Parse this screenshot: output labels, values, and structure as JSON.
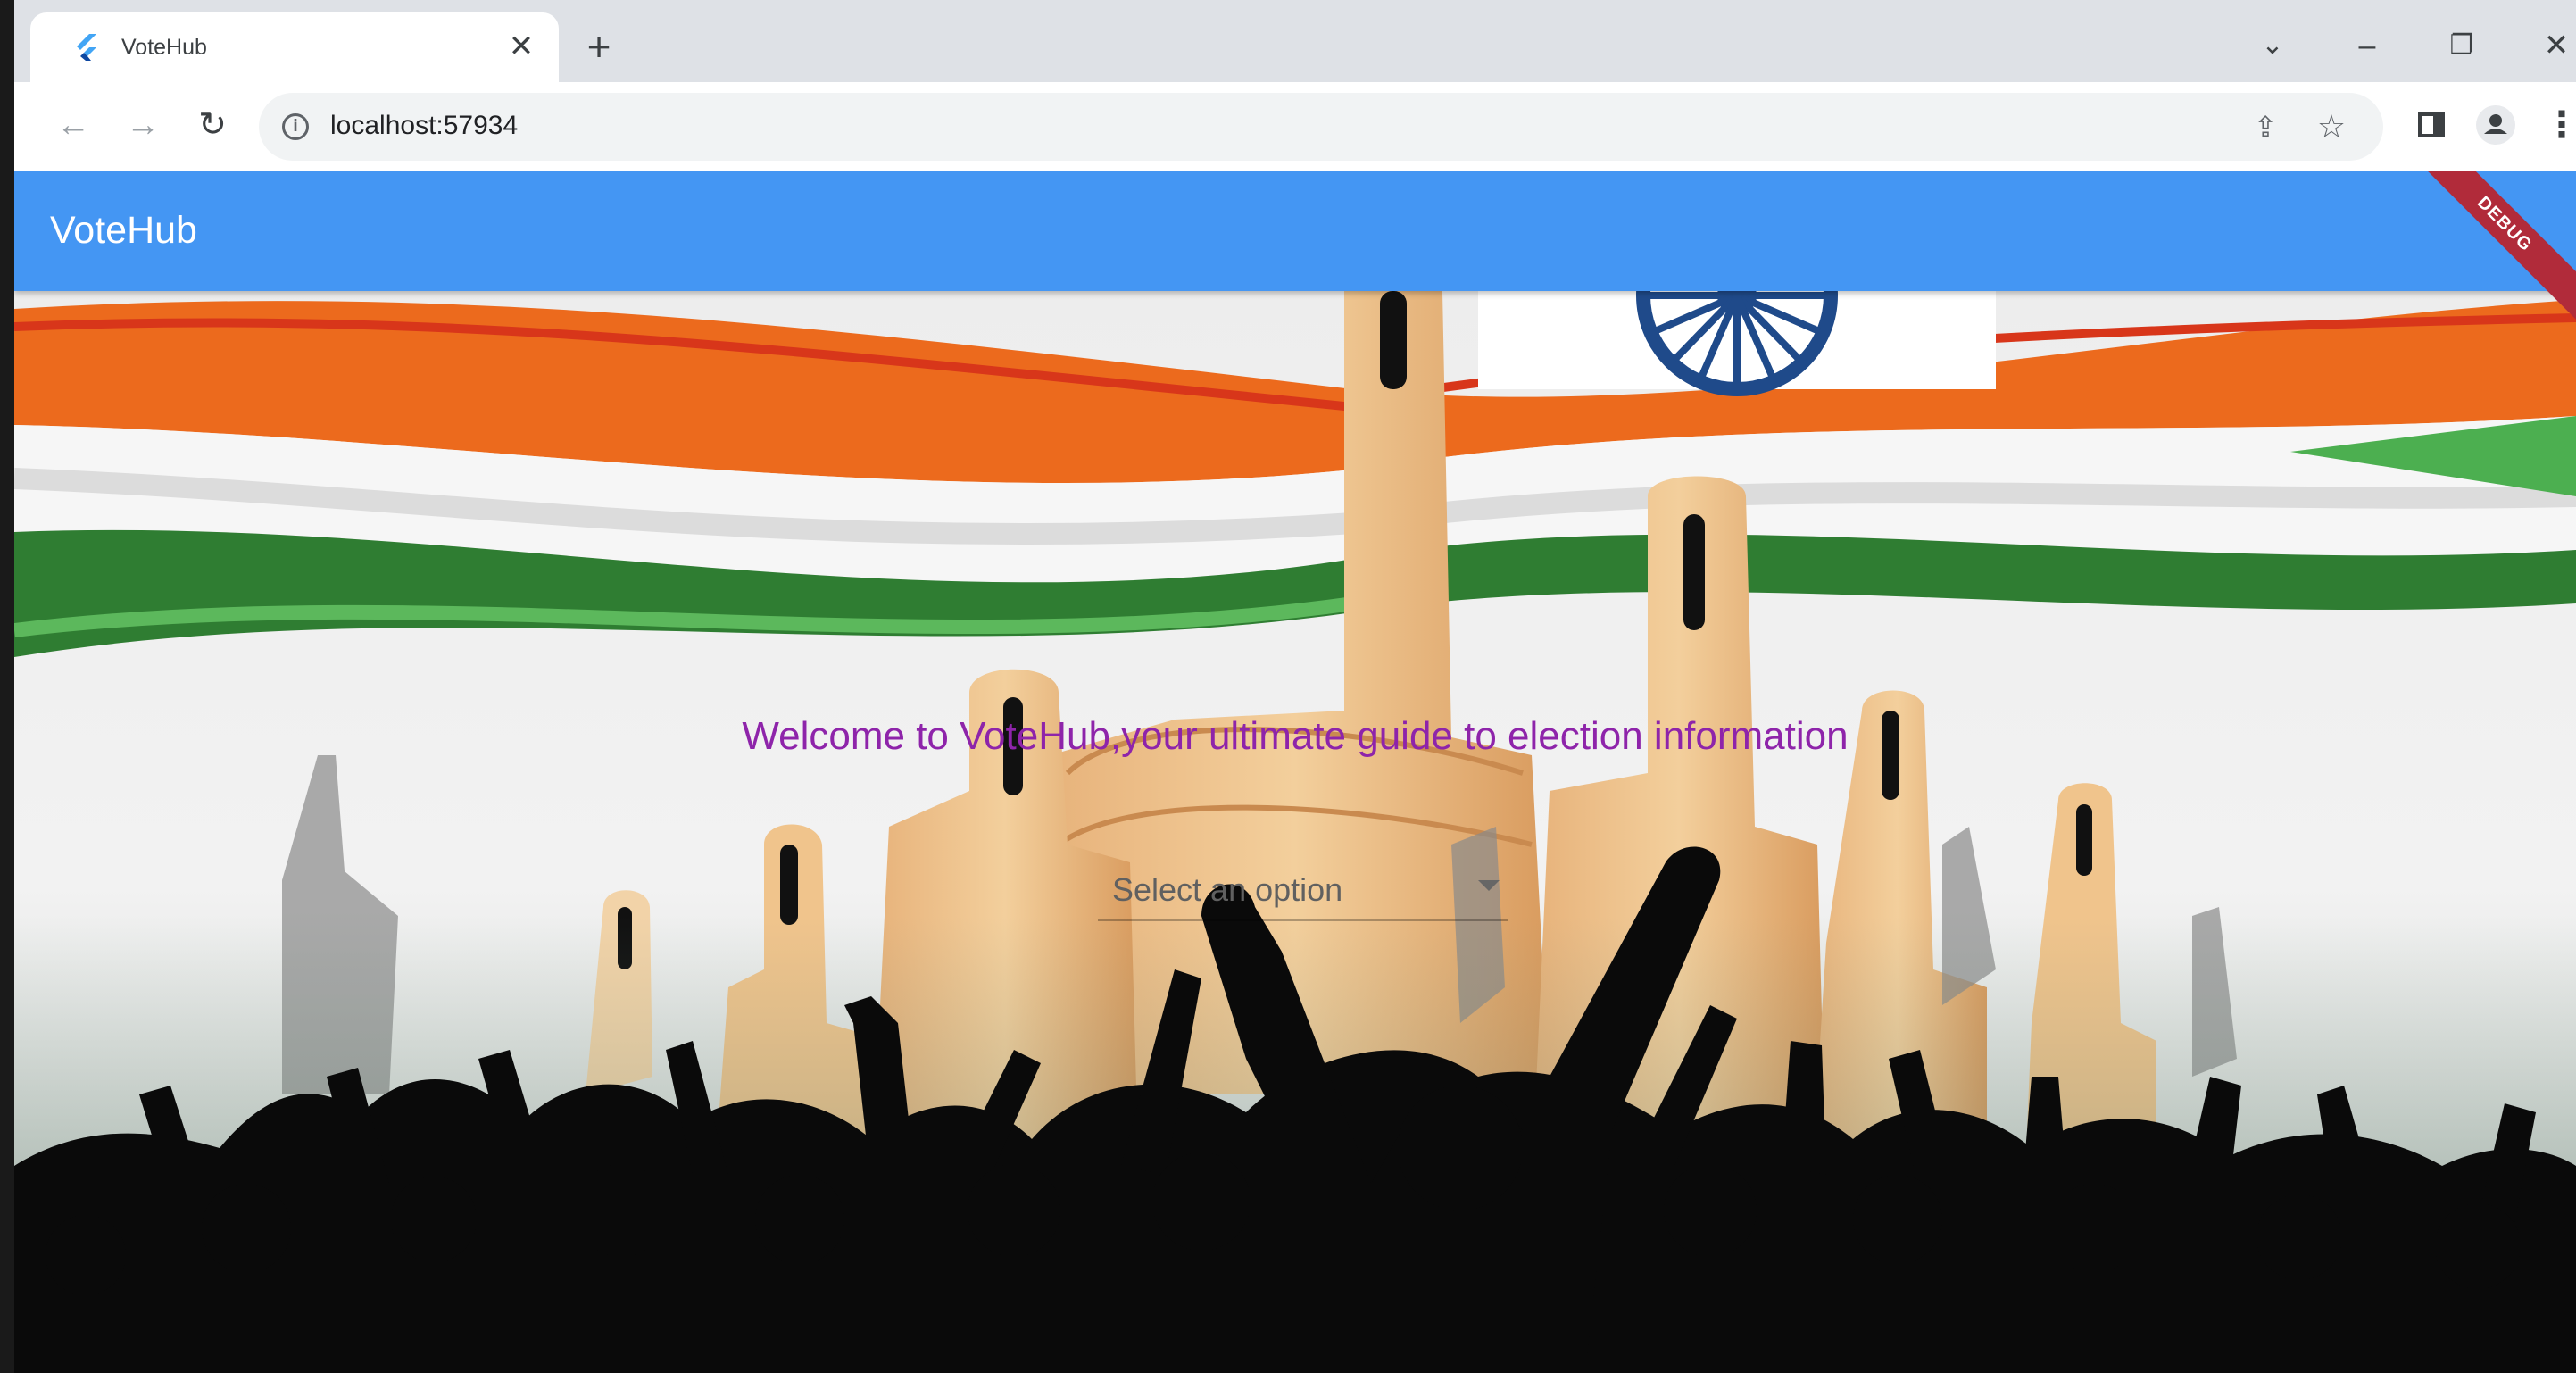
{
  "browser": {
    "tab": {
      "title": "VoteHub",
      "close_glyph": "✕",
      "favicon": "flutter-icon"
    },
    "new_tab_glyph": "+",
    "window_controls": {
      "tab_search_glyph": "⌄",
      "minimize_glyph": "–",
      "restore_glyph": "❐",
      "close_glyph": "✕"
    },
    "nav": {
      "back_glyph": "←",
      "forward_glyph": "→",
      "reload_glyph": "↻"
    },
    "omnibox": {
      "site_info_glyph": "i",
      "url": "localhost:57934"
    },
    "actions": {
      "share_glyph": "⇪",
      "bookmark_glyph": "☆",
      "side_panel": "side-panel-icon",
      "profile": "profile-icon",
      "menu_glyph": "⋮"
    }
  },
  "app": {
    "title": "VoteHub",
    "debug_banner": "DEBUG",
    "welcome": "Welcome to VoteHub,your ultimate guide to election information",
    "dropdown": {
      "placeholder": "Select an option",
      "options": []
    }
  },
  "colors": {
    "appbar": "#4496f3",
    "welcome_text": "#8e24aa",
    "saffron": "#ec6a1d",
    "green": "#2f7d32",
    "chakra": "#1f4a8a"
  }
}
